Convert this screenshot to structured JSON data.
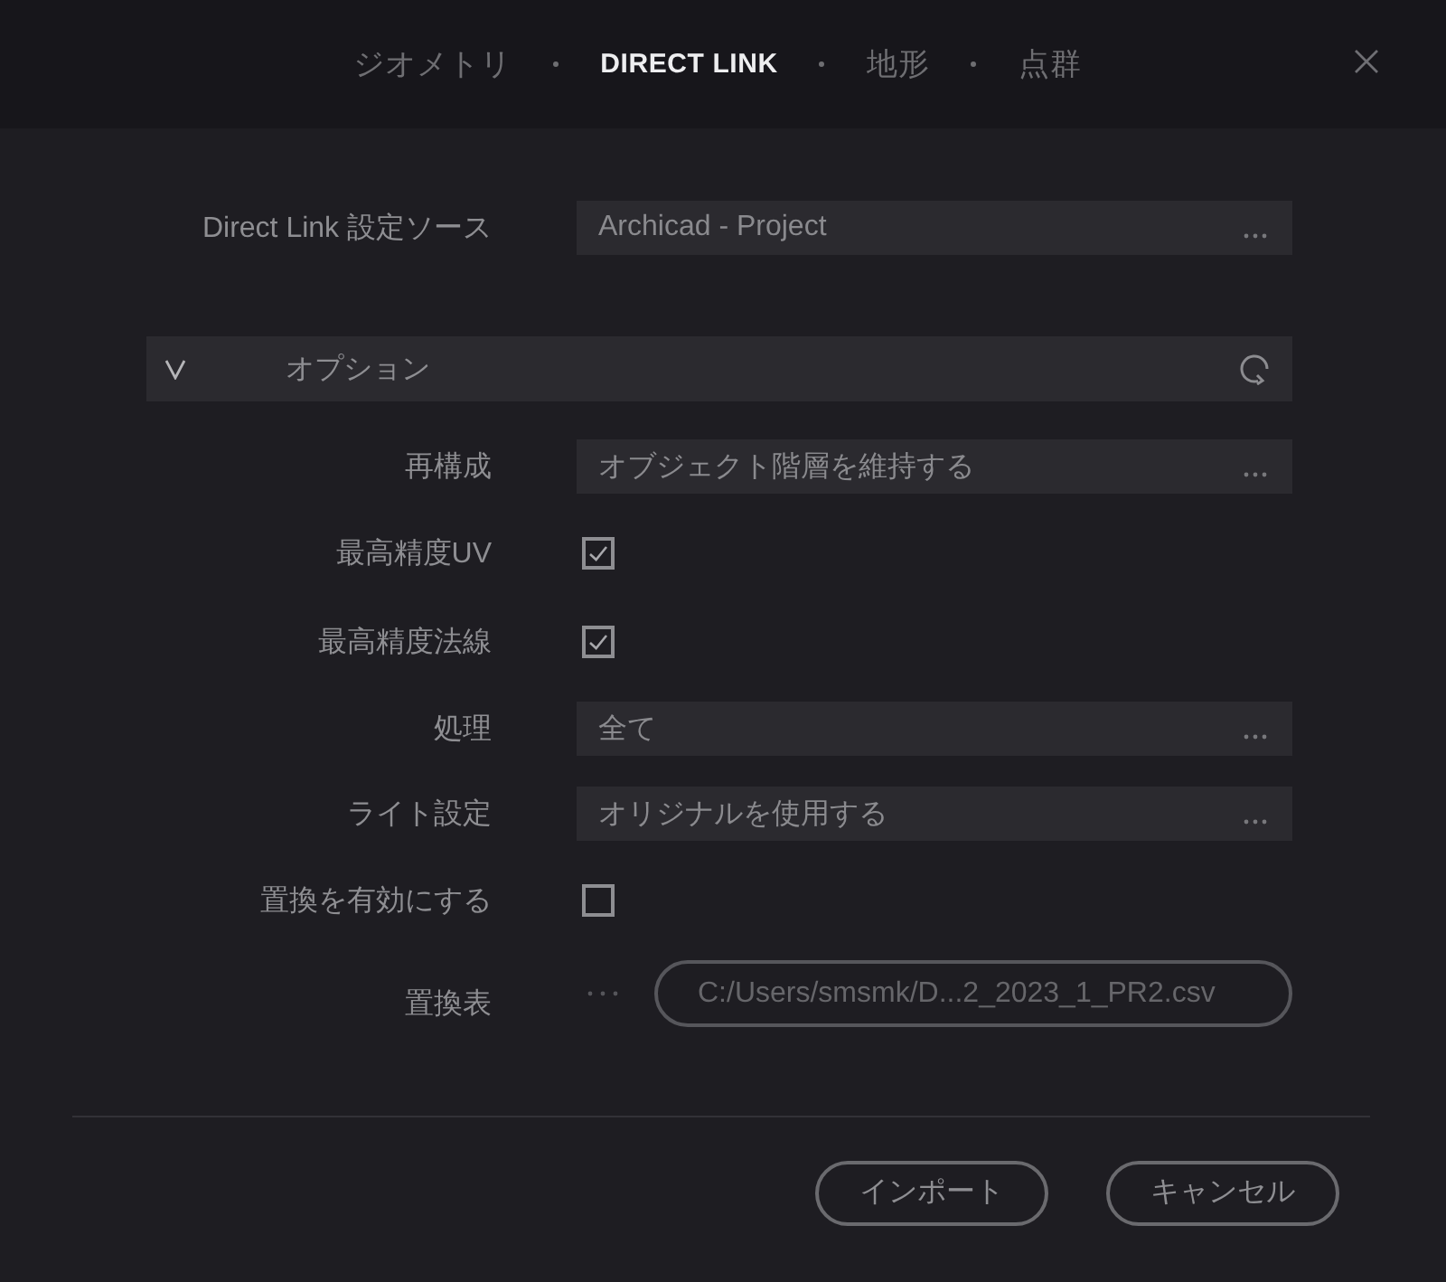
{
  "tabs": [
    {
      "label": "ジオメトリ",
      "selected": false
    },
    {
      "label": "DIRECT LINK",
      "selected": true
    },
    {
      "label": "地形",
      "selected": false
    },
    {
      "label": "点群",
      "selected": false
    }
  ],
  "source": {
    "label": "Direct Link 設定ソース",
    "value": "Archicad - Project"
  },
  "options": {
    "title": "オプション",
    "expanded": true,
    "rows": [
      {
        "kind": "dropdown",
        "label": "再構成",
        "value": "オブジェクト階層を維持する"
      },
      {
        "kind": "checkbox",
        "label": "最高精度UV",
        "checked": true
      },
      {
        "kind": "checkbox",
        "label": "最高精度法線",
        "checked": true
      },
      {
        "kind": "dropdown",
        "label": "処理",
        "value": "全て"
      },
      {
        "kind": "dropdown",
        "label": "ライト設定",
        "value": "オリジナルを使用する"
      },
      {
        "kind": "checkbox",
        "label": "置換を有効にする",
        "checked": false
      },
      {
        "kind": "file",
        "label": "置換表",
        "value": "C:/Users/smsmk/D...2_2023_1_PR2.csv",
        "disabled": true
      }
    ]
  },
  "buttons": [
    "インポート",
    "キャンセル"
  ]
}
